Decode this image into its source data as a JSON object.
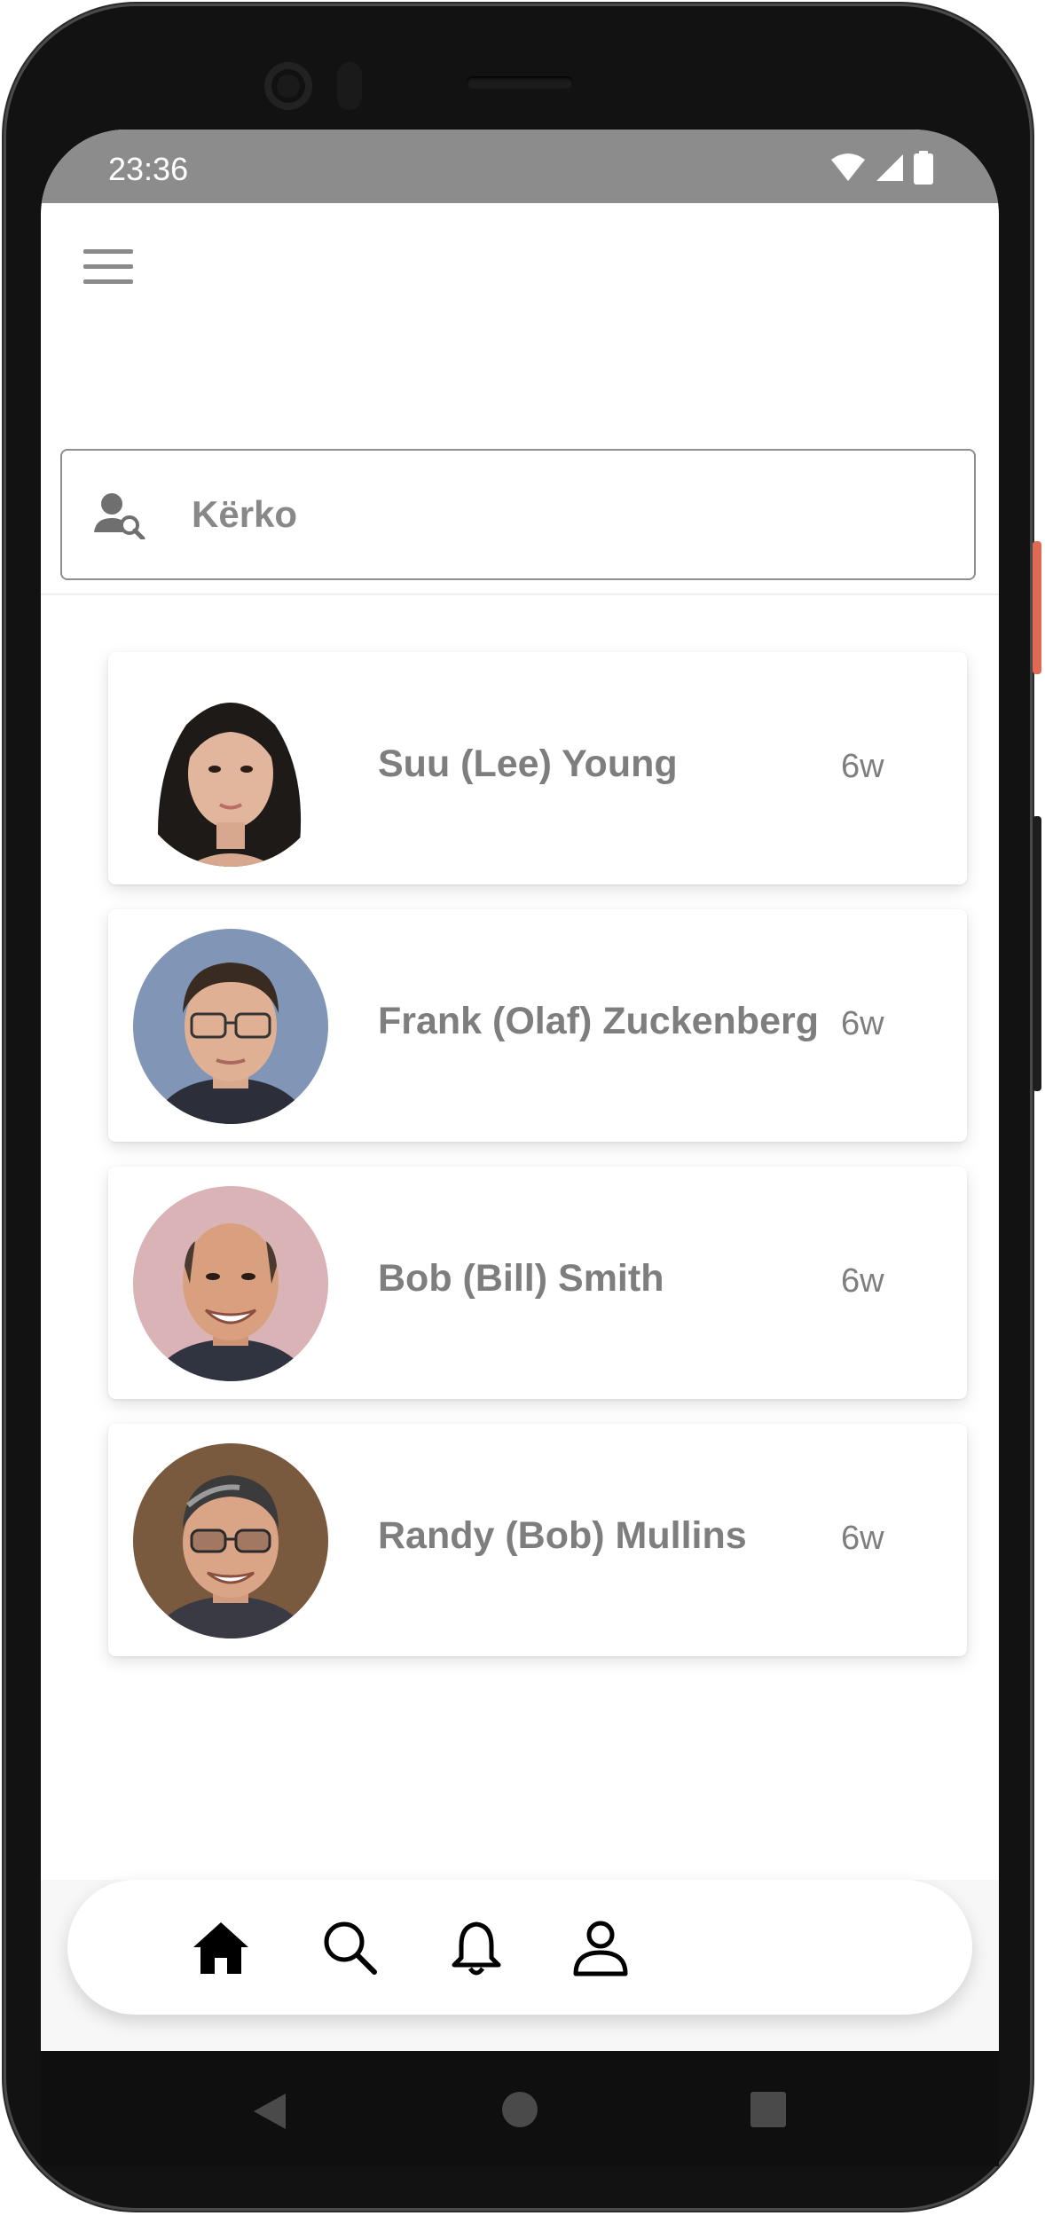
{
  "status_bar": {
    "time": "23:36",
    "icons": [
      "wifi-icon",
      "cellular-signal-icon",
      "battery-icon"
    ]
  },
  "header": {
    "menu_icon": "hamburger-menu-icon"
  },
  "search": {
    "icon": "person-search-icon",
    "placeholder": "Kërko"
  },
  "contacts": [
    {
      "name": "Suu (Lee) Young",
      "time": "6w",
      "avatar": "avatar-woman-dark-hair"
    },
    {
      "name": "Frank (Olaf) Zuckenberg",
      "time": "6w",
      "avatar": "avatar-man-glasses"
    },
    {
      "name": "Bob (Bill) Smith",
      "time": "6w",
      "avatar": "avatar-man-bald-smiling"
    },
    {
      "name": "Randy (Bob) Mullins",
      "time": "6w",
      "avatar": "avatar-man-glasses-gray-hair"
    }
  ],
  "bottom_nav": {
    "items": [
      "home-icon",
      "search-icon",
      "bell-icon",
      "profile-icon"
    ]
  },
  "system_nav": {
    "items": [
      "back-icon",
      "home-circle-icon",
      "recents-icon"
    ]
  },
  "colors": {
    "status_bar": "#8c8c8c",
    "text_gray": "#7e7e7e",
    "accent_side_button": "#e06a55"
  }
}
